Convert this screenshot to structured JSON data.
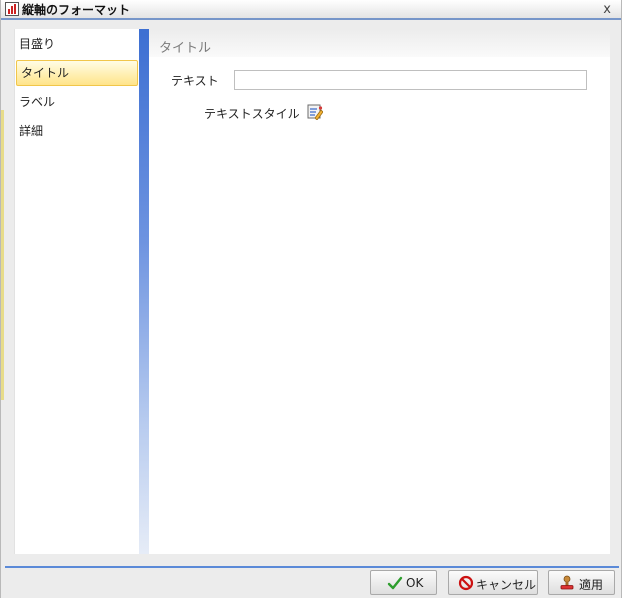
{
  "window": {
    "title": "縦軸のフォーマット",
    "close_glyph": "x"
  },
  "sidebar": {
    "items": [
      {
        "label": "目盛り",
        "selected": false
      },
      {
        "label": "タイトル",
        "selected": true
      },
      {
        "label": "ラベル",
        "selected": false
      },
      {
        "label": "詳細",
        "selected": false
      }
    ]
  },
  "panel": {
    "title": "タイトル",
    "text_label": "テキスト",
    "text_value": "",
    "text_style_label": "テキストスタイル"
  },
  "buttons": {
    "ok": "OK",
    "cancel": "キャンセル",
    "apply": "適用"
  },
  "colors": {
    "selected_bg": "#ffe48a",
    "accent_blue": "#3d6fd2",
    "cancel_red": "#cc1111",
    "ok_green": "#2e9e2e"
  }
}
